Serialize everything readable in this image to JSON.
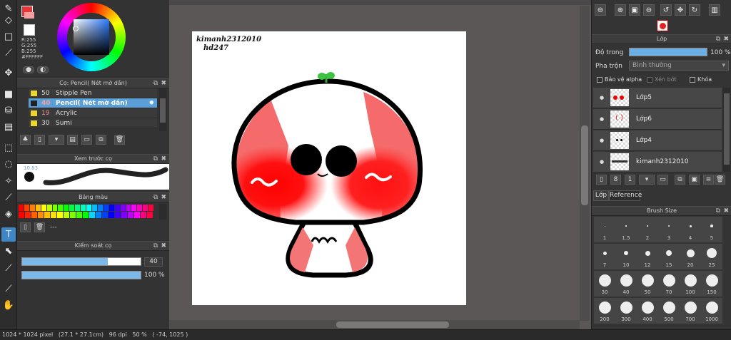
{
  "colors": {
    "accent": "#5b9fd8",
    "panel": "#333333",
    "canvas_bg": "#5a5756"
  },
  "color_panel": {
    "r": "R:255",
    "g": "G:255",
    "b": "B:255",
    "hex": "#FFFFFF"
  },
  "brush_panel": {
    "title": "Cọ: Pencil( Nét mờ dần)",
    "items": [
      {
        "num": "50",
        "label": "Stipple Pen"
      },
      {
        "num": "40",
        "label": "Pencil( Nét mờ dần)"
      },
      {
        "num": "19",
        "label": "Acrylic"
      },
      {
        "num": "30",
        "label": "Sumi"
      }
    ]
  },
  "preview_panel": {
    "title": "Xem trước cọ",
    "size_label": "10.83"
  },
  "palette_panel": {
    "title": "Bảng màu",
    "swatch_colors": [
      "#ff0000",
      "#ff4000",
      "#ff8000",
      "#ffbf00",
      "#ffff00",
      "#bfff00",
      "#80ff00",
      "#40ff00",
      "#00ff00",
      "#00ff40",
      "#00ff80",
      "#00ffbf",
      "#00ffff",
      "#00bfff",
      "#0080ff",
      "#0040ff",
      "#0000ff",
      "#4000ff",
      "#8000ff",
      "#bf00ff",
      "#ff00ff",
      "#ff00bf",
      "#ff0080",
      "#ff0040"
    ],
    "swatch_colors2": [
      "#ff0000",
      "#ff2000",
      "#ff6000",
      "#ff9000",
      "#ffc000",
      "#ffe000",
      "#ffff00",
      "#c0ff00",
      "#80ff00",
      "#40ff00",
      "#00ff00",
      "#00d8ff",
      "#0080ff",
      "#0040ff",
      "#0000ff",
      "#4000ff",
      "#8000ff",
      "#c000ff",
      "#ff00ff",
      "#ff0080",
      "#ff0040"
    ],
    "dashes": "---"
  },
  "control_panel": {
    "title": "Kiểm soát cọ",
    "size_value": "40",
    "size_fraction": 0.72,
    "opacity_value": "100 %",
    "opacity_fraction": 1.0
  },
  "canvas": {
    "watermark_line1": "kimanh2312010",
    "watermark_line2": "hd247"
  },
  "layer_panel": {
    "title": "Lớp",
    "opacity_label": "Độ trong",
    "opacity_value": "100 %",
    "opacity_fraction": 1.0,
    "blend_label": "Pha trộn",
    "blend_value": "Bình thường",
    "protect_alpha": "Bảo vệ alpha",
    "clipping": "Xén bớt",
    "lock": "Khóa",
    "layers": [
      {
        "name": "Lớp5"
      },
      {
        "name": "Lớp6"
      },
      {
        "name": "Lớp4"
      },
      {
        "name": "kimanh2312010"
      }
    ],
    "tabs": [
      "Lớp",
      "Reference"
    ]
  },
  "brush_size_panel": {
    "title": "Brush Size",
    "sizes": [
      "1",
      "1.5",
      "2",
      "3",
      "4",
      "5",
      "7",
      "10",
      "12",
      "15",
      "20",
      "25",
      "30",
      "40",
      "50",
      "70",
      "100",
      "150",
      "200",
      "300",
      "400",
      "500",
      "700",
      "1000"
    ]
  },
  "status": {
    "text": "1024 * 1024 pixel   (27.1 * 27.1cm)   96 dpi   50 %   ( -74, 1025 )"
  }
}
